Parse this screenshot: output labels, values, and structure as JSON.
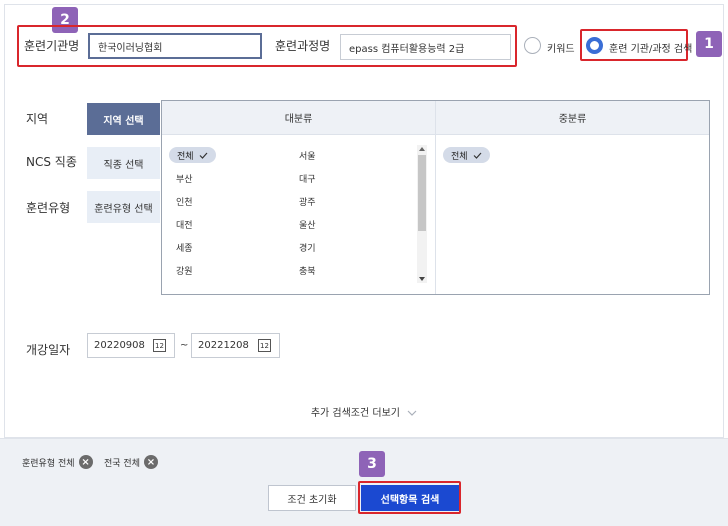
{
  "form": {
    "institution_label": "훈련기관명",
    "institution_value": "한국이러닝협회",
    "course_label": "훈련과정명",
    "course_value": "epass 컴퓨터활용능력 2급",
    "radio_keyword": "키워드",
    "radio_inst_course": "훈련 기관/과정 검색",
    "region_label": "지역",
    "ncs_label": "NCS 직종",
    "type_label": "훈련유형",
    "date_label": "개강일자"
  },
  "tabs": {
    "region": "지역 선택",
    "job": "직종 선택",
    "type": "훈련유형 선택"
  },
  "panel": {
    "major_header": "대분류",
    "minor_header": "중분류",
    "all_chip": "전체",
    "minor_all_chip": "전체",
    "check_icon": "check-icon",
    "regions_left": [
      "부산",
      "인천",
      "대전",
      "세종",
      "강원"
    ],
    "regions_right": [
      "서울",
      "대구",
      "광주",
      "울산",
      "경기",
      "충북"
    ]
  },
  "dates": {
    "start": "20220908",
    "end": "20221208",
    "separator": "~",
    "icon_text": "12"
  },
  "more_conditions": "추가 검색조건 더보기",
  "selected_tags": {
    "tag1": "훈련유형 전체",
    "tag2": "전국 전체"
  },
  "buttons": {
    "reset": "조건 초기화",
    "search": "선택항목 검색"
  },
  "badges": {
    "b1": "1",
    "b2": "2",
    "b3": "3"
  },
  "colors": {
    "accent": "#1b49d1",
    "badge": "#8e63b7",
    "highlight": "#d9262c",
    "active_tab": "#5b6d96"
  }
}
